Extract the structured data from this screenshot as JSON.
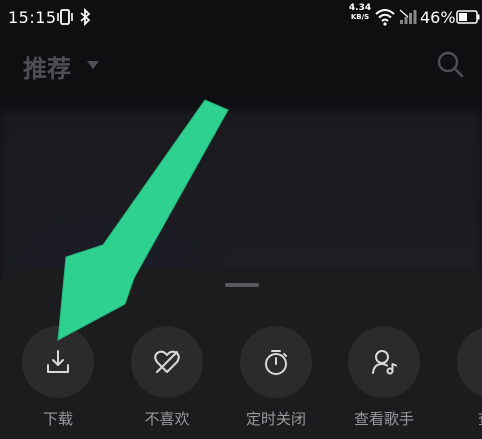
{
  "status_bar": {
    "time": "15:15",
    "net_speed_value": "4.34",
    "net_speed_unit": "KB/S",
    "battery_percent": "46%",
    "icons": [
      "vibrate-icon",
      "bluetooth-icon",
      "wifi-icon",
      "signal-icon",
      "battery-icon"
    ]
  },
  "header": {
    "title": "推荐",
    "icons": [
      "caret-down-icon",
      "search-icon"
    ]
  },
  "sheet": {
    "actions": [
      {
        "label": "下载",
        "icon": "download-icon"
      },
      {
        "label": "不喜欢",
        "icon": "dislike-heart-icon"
      },
      {
        "label": "定时关闭",
        "icon": "timer-icon"
      },
      {
        "label": "查看歌手",
        "icon": "view-singer-icon"
      },
      {
        "label": "查看",
        "icon": "more-icon"
      }
    ]
  },
  "annotation": {
    "color": "#2ed18f",
    "points_to": "下载"
  }
}
